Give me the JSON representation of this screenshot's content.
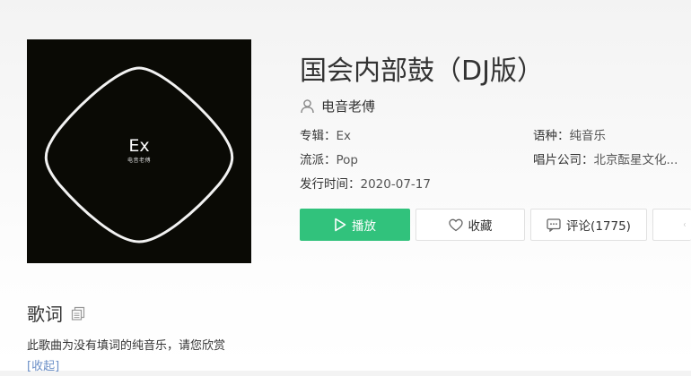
{
  "cover": {
    "title": "Ex",
    "subtitle": "电音老傅"
  },
  "song": {
    "title": "国会内部鼓（DJ版）",
    "artist": "电音老傅"
  },
  "meta": {
    "album_label": "专辑：",
    "album_value": "Ex",
    "language_label": "语种：",
    "language_value": "纯音乐",
    "genre_label": "流派：",
    "genre_value": "Pop",
    "label_label": "唱片公司：",
    "label_value": "北京酝星文化...",
    "release_label": "发行时间：",
    "release_value": "2020-07-17"
  },
  "actions": {
    "play_label": "播放",
    "favorite_label": "收藏",
    "comment_label": "评论(1775)"
  },
  "lyrics": {
    "heading": "歌词",
    "text": "此歌曲为没有填词的纯音乐，请您欣赏",
    "collapse_label": "[收起]"
  },
  "colors": {
    "accent": "#31c27c",
    "link": "#6b8fc7",
    "cover_bg": "#0a0a05"
  },
  "icons": [
    "user-icon",
    "play-icon",
    "heart-icon",
    "comment-icon",
    "more-icon",
    "copy-icon"
  ]
}
